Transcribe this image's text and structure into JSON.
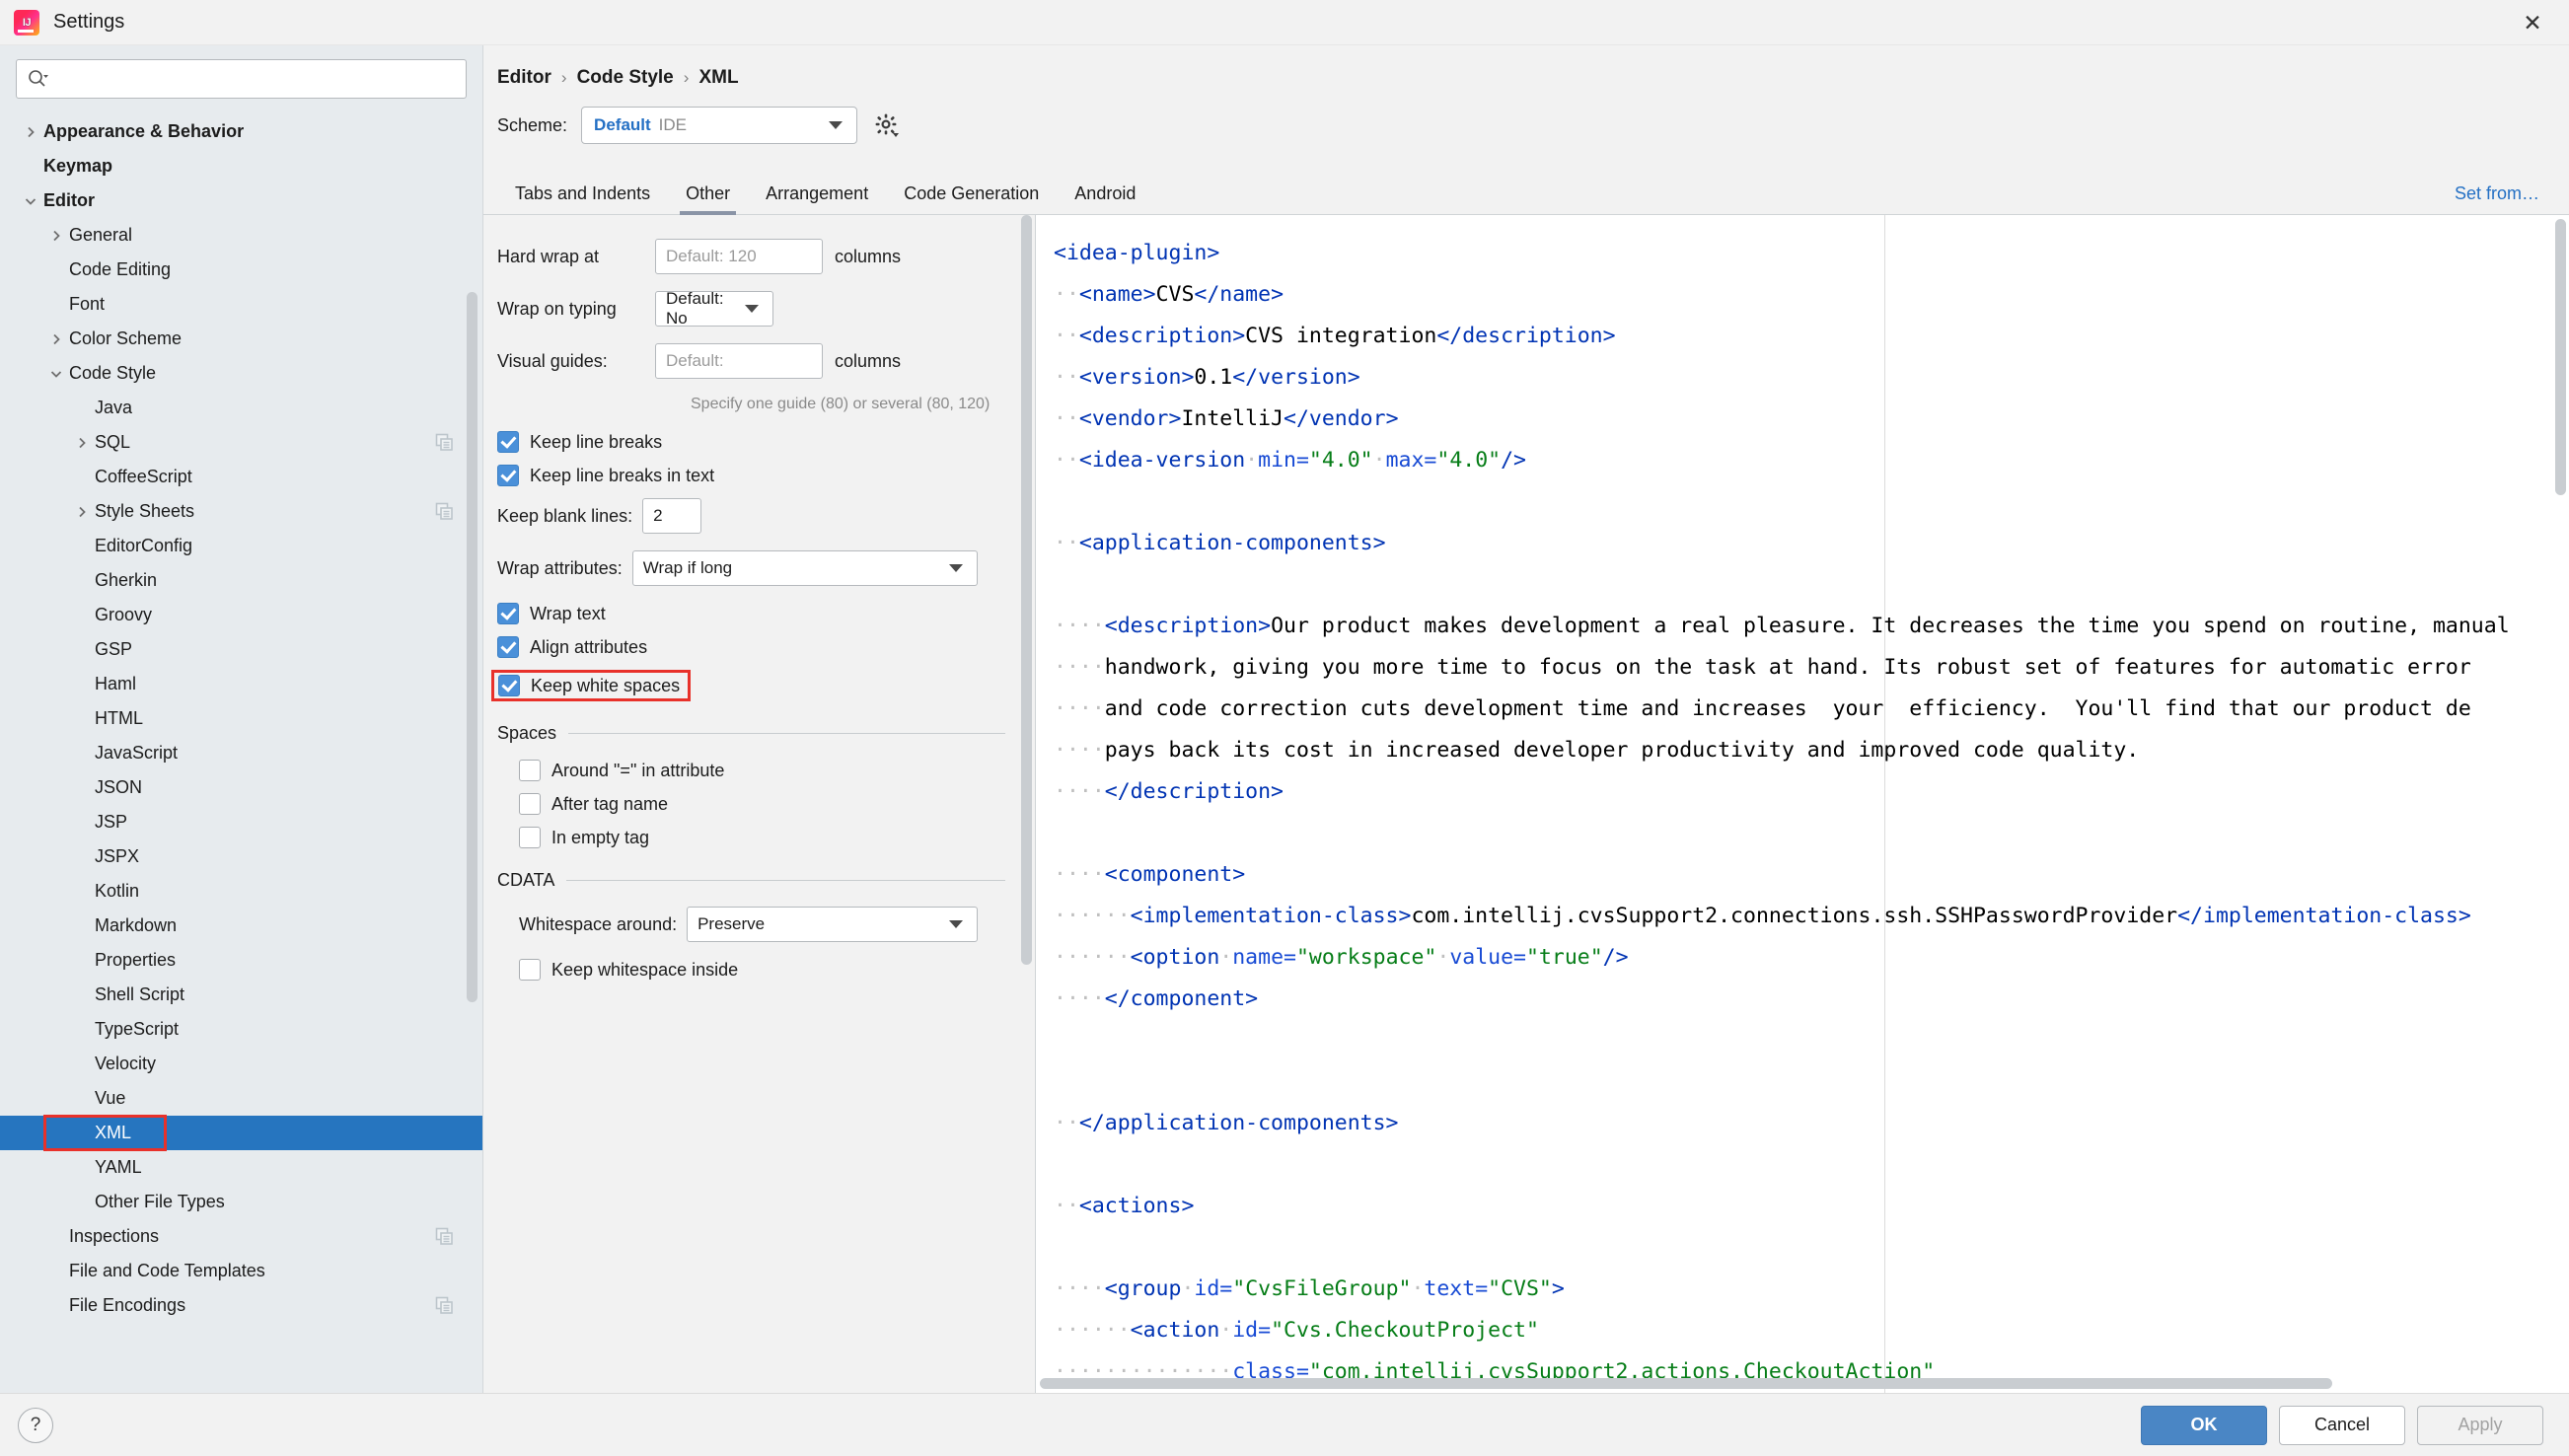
{
  "window": {
    "title": "Settings",
    "logo_icon": "intellij-idea-logo",
    "close_icon": "close-icon"
  },
  "sidebar": {
    "search": {
      "placeholder": "",
      "value": "",
      "icon": "search-icon"
    },
    "items": [
      {
        "label": "Appearance & Behavior",
        "depth": 0,
        "twisty": "right",
        "bold": true,
        "copy": false,
        "selected": false
      },
      {
        "label": "Keymap",
        "depth": 0,
        "twisty": "none",
        "bold": true,
        "copy": false,
        "selected": false
      },
      {
        "label": "Editor",
        "depth": 0,
        "twisty": "down",
        "bold": true,
        "copy": false,
        "selected": false
      },
      {
        "label": "General",
        "depth": 1,
        "twisty": "right",
        "bold": false,
        "copy": false,
        "selected": false
      },
      {
        "label": "Code Editing",
        "depth": 1,
        "twisty": "none",
        "bold": false,
        "copy": false,
        "selected": false
      },
      {
        "label": "Font",
        "depth": 1,
        "twisty": "none",
        "bold": false,
        "copy": false,
        "selected": false
      },
      {
        "label": "Color Scheme",
        "depth": 1,
        "twisty": "right",
        "bold": false,
        "copy": false,
        "selected": false
      },
      {
        "label": "Code Style",
        "depth": 1,
        "twisty": "down",
        "bold": false,
        "copy": false,
        "selected": false
      },
      {
        "label": "Java",
        "depth": 2,
        "twisty": "none",
        "bold": false,
        "copy": false,
        "selected": false
      },
      {
        "label": "SQL",
        "depth": 2,
        "twisty": "right",
        "bold": false,
        "copy": true,
        "selected": false
      },
      {
        "label": "CoffeeScript",
        "depth": 2,
        "twisty": "none",
        "bold": false,
        "copy": false,
        "selected": false
      },
      {
        "label": "Style Sheets",
        "depth": 2,
        "twisty": "right",
        "bold": false,
        "copy": true,
        "selected": false
      },
      {
        "label": "EditorConfig",
        "depth": 2,
        "twisty": "none",
        "bold": false,
        "copy": false,
        "selected": false
      },
      {
        "label": "Gherkin",
        "depth": 2,
        "twisty": "none",
        "bold": false,
        "copy": false,
        "selected": false
      },
      {
        "label": "Groovy",
        "depth": 2,
        "twisty": "none",
        "bold": false,
        "copy": false,
        "selected": false
      },
      {
        "label": "GSP",
        "depth": 2,
        "twisty": "none",
        "bold": false,
        "copy": false,
        "selected": false
      },
      {
        "label": "Haml",
        "depth": 2,
        "twisty": "none",
        "bold": false,
        "copy": false,
        "selected": false
      },
      {
        "label": "HTML",
        "depth": 2,
        "twisty": "none",
        "bold": false,
        "copy": false,
        "selected": false
      },
      {
        "label": "JavaScript",
        "depth": 2,
        "twisty": "none",
        "bold": false,
        "copy": false,
        "selected": false
      },
      {
        "label": "JSON",
        "depth": 2,
        "twisty": "none",
        "bold": false,
        "copy": false,
        "selected": false
      },
      {
        "label": "JSP",
        "depth": 2,
        "twisty": "none",
        "bold": false,
        "copy": false,
        "selected": false
      },
      {
        "label": "JSPX",
        "depth": 2,
        "twisty": "none",
        "bold": false,
        "copy": false,
        "selected": false
      },
      {
        "label": "Kotlin",
        "depth": 2,
        "twisty": "none",
        "bold": false,
        "copy": false,
        "selected": false
      },
      {
        "label": "Markdown",
        "depth": 2,
        "twisty": "none",
        "bold": false,
        "copy": false,
        "selected": false
      },
      {
        "label": "Properties",
        "depth": 2,
        "twisty": "none",
        "bold": false,
        "copy": false,
        "selected": false
      },
      {
        "label": "Shell Script",
        "depth": 2,
        "twisty": "none",
        "bold": false,
        "copy": false,
        "selected": false
      },
      {
        "label": "TypeScript",
        "depth": 2,
        "twisty": "none",
        "bold": false,
        "copy": false,
        "selected": false
      },
      {
        "label": "Velocity",
        "depth": 2,
        "twisty": "none",
        "bold": false,
        "copy": false,
        "selected": false
      },
      {
        "label": "Vue",
        "depth": 2,
        "twisty": "none",
        "bold": false,
        "copy": false,
        "selected": false
      },
      {
        "label": "XML",
        "depth": 2,
        "twisty": "none",
        "bold": false,
        "copy": false,
        "selected": true,
        "outlined": true
      },
      {
        "label": "YAML",
        "depth": 2,
        "twisty": "none",
        "bold": false,
        "copy": false,
        "selected": false
      },
      {
        "label": "Other File Types",
        "depth": 2,
        "twisty": "none",
        "bold": false,
        "copy": false,
        "selected": false
      },
      {
        "label": "Inspections",
        "depth": 1,
        "twisty": "none",
        "bold": false,
        "copy": true,
        "selected": false
      },
      {
        "label": "File and Code Templates",
        "depth": 1,
        "twisty": "none",
        "bold": false,
        "copy": false,
        "selected": false
      },
      {
        "label": "File Encodings",
        "depth": 1,
        "twisty": "none",
        "bold": false,
        "copy": true,
        "selected": false
      }
    ]
  },
  "main": {
    "breadcrumb": [
      "Editor",
      "Code Style",
      "XML"
    ],
    "breadcrumb_separator": "›",
    "scheme_label": "Scheme:",
    "scheme_name": "Default",
    "scheme_kind": "IDE",
    "gear_icon": "gear-icon",
    "set_from_link": "Set from…",
    "tabs": [
      {
        "label": "Tabs and Indents",
        "active": false
      },
      {
        "label": "Other",
        "active": true
      },
      {
        "label": "Arrangement",
        "active": false
      },
      {
        "label": "Code Generation",
        "active": false
      },
      {
        "label": "Android",
        "active": false
      }
    ]
  },
  "form": {
    "hard_wrap": {
      "label": "Hard wrap at",
      "placeholder": "Default: 120",
      "value": "",
      "suffix": "columns"
    },
    "wrap_on_typing": {
      "label": "Wrap on typing",
      "value": "Default: No"
    },
    "visual_guides": {
      "label": "Visual guides:",
      "placeholder": "Default:",
      "value": "",
      "suffix": "columns"
    },
    "visual_guides_hint": "Specify one guide (80) or several (80, 120)",
    "keep_line_breaks": {
      "label": "Keep line breaks",
      "checked": true
    },
    "keep_line_breaks_in_text": {
      "label": "Keep line breaks in text",
      "checked": true
    },
    "keep_blank_lines": {
      "label": "Keep blank lines:",
      "value": "2"
    },
    "wrap_attributes": {
      "label": "Wrap attributes:",
      "value": "Wrap if long"
    },
    "wrap_text": {
      "label": "Wrap text",
      "checked": true
    },
    "align_attributes": {
      "label": "Align attributes",
      "checked": true
    },
    "keep_white_spaces": {
      "label": "Keep white spaces",
      "checked": true,
      "outlined": true
    },
    "spaces_section": "Spaces",
    "around_eq": {
      "label": "Around \"=\" in attribute",
      "checked": false
    },
    "after_tag_name": {
      "label": "After tag name",
      "checked": false
    },
    "in_empty_tag": {
      "label": "In empty tag",
      "checked": false
    },
    "cdata_section": "CDATA",
    "whitespace_around": {
      "label": "Whitespace around:",
      "value": "Preserve"
    },
    "keep_whitespace_inside": {
      "label": "Keep whitespace inside",
      "checked": false
    }
  },
  "preview": {
    "lines": [
      [
        [
          "tg",
          "<idea-plugin>"
        ]
      ],
      [
        [
          "ws",
          "··"
        ],
        [
          "tg",
          "<name>"
        ],
        [
          "",
          "CVS"
        ],
        [
          "tg",
          "</name>"
        ]
      ],
      [
        [
          "ws",
          "··"
        ],
        [
          "tg",
          "<description>"
        ],
        [
          "",
          "CVS integration"
        ],
        [
          "tg",
          "</description>"
        ]
      ],
      [
        [
          "ws",
          "··"
        ],
        [
          "tg",
          "<version>"
        ],
        [
          "",
          "0.1"
        ],
        [
          "tg",
          "</version>"
        ]
      ],
      [
        [
          "ws",
          "··"
        ],
        [
          "tg",
          "<vendor>"
        ],
        [
          "",
          "IntelliJ"
        ],
        [
          "tg",
          "</vendor>"
        ]
      ],
      [
        [
          "ws",
          "··"
        ],
        [
          "tg",
          "<idea-version"
        ],
        [
          "ws",
          "·"
        ],
        [
          "at",
          "min="
        ],
        [
          "av",
          "\"4.0\""
        ],
        [
          "ws",
          "·"
        ],
        [
          "at",
          "max="
        ],
        [
          "av",
          "\"4.0\""
        ],
        [
          "tg",
          "/>"
        ]
      ],
      [],
      [
        [
          "ws",
          "··"
        ],
        [
          "tg",
          "<application-components>"
        ]
      ],
      [],
      [
        [
          "ws",
          "····"
        ],
        [
          "tg",
          "<description>"
        ],
        [
          "",
          "Our product makes development a real pleasure. It decreases the time you spend on routine, manual"
        ]
      ],
      [
        [
          "ws",
          "····"
        ],
        [
          "",
          "handwork, giving you more time to focus on the task at hand. Its robust set of features for automatic error"
        ]
      ],
      [
        [
          "ws",
          "····"
        ],
        [
          "",
          "and code correction cuts development time and increases  your  efficiency.  You'll find that our product de"
        ]
      ],
      [
        [
          "ws",
          "····"
        ],
        [
          "",
          "pays back its cost in increased developer productivity and improved code quality."
        ]
      ],
      [
        [
          "ws",
          "····"
        ],
        [
          "tg",
          "</description>"
        ]
      ],
      [],
      [
        [
          "ws",
          "····"
        ],
        [
          "tg",
          "<component>"
        ]
      ],
      [
        [
          "ws",
          "······"
        ],
        [
          "tg",
          "<implementation-class>"
        ],
        [
          "",
          "com.intellij.cvsSupport2.connections.ssh.SSHPasswordProvider"
        ],
        [
          "tg",
          "</implementation-class>"
        ]
      ],
      [
        [
          "ws",
          "······"
        ],
        [
          "tg",
          "<option"
        ],
        [
          "ws",
          "·"
        ],
        [
          "at",
          "name="
        ],
        [
          "av",
          "\"workspace\""
        ],
        [
          "ws",
          "·"
        ],
        [
          "at",
          "value="
        ],
        [
          "av",
          "\"true\""
        ],
        [
          "tg",
          "/>"
        ]
      ],
      [
        [
          "ws",
          "····"
        ],
        [
          "tg",
          "</component>"
        ]
      ],
      [],
      [],
      [
        [
          "ws",
          "··"
        ],
        [
          "tg",
          "</application-components>"
        ]
      ],
      [],
      [
        [
          "ws",
          "··"
        ],
        [
          "tg",
          "<actions>"
        ]
      ],
      [],
      [
        [
          "ws",
          "····"
        ],
        [
          "tg",
          "<group"
        ],
        [
          "ws",
          "·"
        ],
        [
          "at",
          "id="
        ],
        [
          "av",
          "\"CvsFileGroup\""
        ],
        [
          "ws",
          "·"
        ],
        [
          "at",
          "text="
        ],
        [
          "av",
          "\"CVS\""
        ],
        [
          "tg",
          ">"
        ]
      ],
      [
        [
          "ws",
          "······"
        ],
        [
          "tg",
          "<action"
        ],
        [
          "ws",
          "·"
        ],
        [
          "at",
          "id="
        ],
        [
          "av",
          "\"Cvs.CheckoutProject\""
        ]
      ],
      [
        [
          "ws",
          "··············"
        ],
        [
          "at",
          "class="
        ],
        [
          "av",
          "\"com.intellij.cvsSupport2.actions.CheckoutAction\""
        ]
      ]
    ]
  },
  "footer": {
    "help_icon": "help-icon",
    "help_label": "?",
    "ok": "OK",
    "cancel": "Cancel",
    "apply": "Apply"
  },
  "colors": {
    "accent": "#2675bf",
    "highlight_outline": "#e8312a",
    "link": "#2470c4",
    "tag": "#0033b3",
    "attr": "#174ad4",
    "value": "#067d17"
  }
}
